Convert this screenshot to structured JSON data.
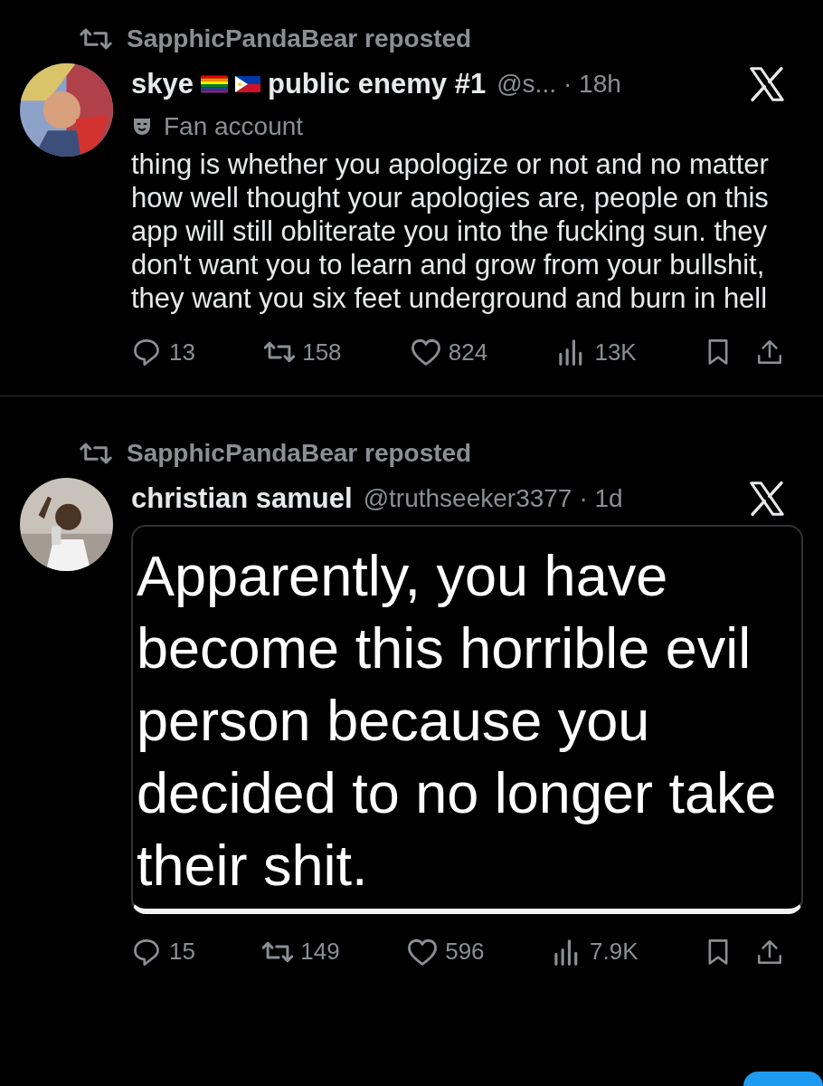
{
  "tweets": [
    {
      "repost_by": "SapphicPandaBear reposted",
      "name": "skye",
      "flags": [
        {
          "kind": "pride"
        },
        {
          "kind": "philippines"
        }
      ],
      "name_suffix": "public enemy #1",
      "handle": "@s...",
      "time": "· 18h",
      "label": "Fan account",
      "text": "thing is whether you apologize or not and no matter how well thought your apologies are, people on this app will still obliterate you into the fucking sun. they don't want you to learn and grow from your bullshit, they want you six feet underground and burn in hell",
      "stats": {
        "replies": "13",
        "reposts": "158",
        "likes": "824",
        "views": "13K"
      }
    },
    {
      "repost_by": "SapphicPandaBear reposted",
      "name": "christian samuel",
      "handle": "@truthseeker3377",
      "time": "· 1d",
      "media_text": "Apparently,  you have become this horrible evil person because you decided to no longer take their shit.",
      "stats": {
        "replies": "15",
        "reposts": "149",
        "likes": "596",
        "views": "7.9K"
      }
    }
  ]
}
